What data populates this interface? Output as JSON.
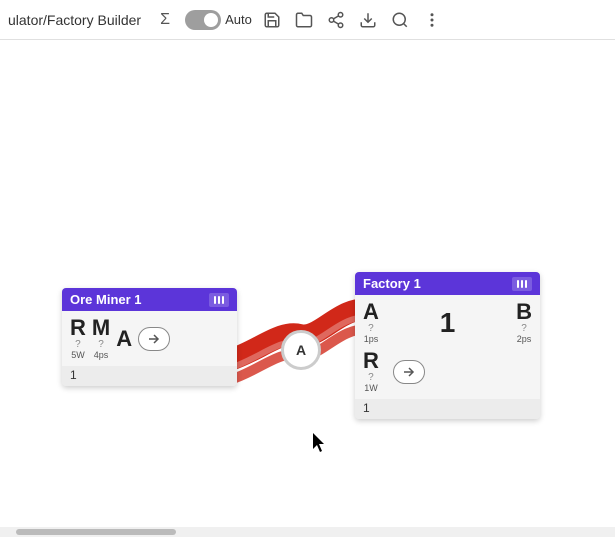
{
  "toolbar": {
    "title": "ulator/Factory Builder",
    "sigma_label": "Σ",
    "auto_label": "Auto",
    "save_label": "💾",
    "folder_label": "📁",
    "share_label": "⬡",
    "download_label": "⬇",
    "search_label": "🔍",
    "more_label": "⋮"
  },
  "ore_miner_node": {
    "title": "Ore Miner 1",
    "footer": "1",
    "port_r": {
      "letter": "R",
      "question": "?",
      "rate": "5W"
    },
    "port_m": {
      "letter": "M",
      "question": "?",
      "rate": "4ps"
    },
    "port_a": {
      "letter": "A"
    },
    "arrow_label": "→"
  },
  "factory_node": {
    "title": "Factory 1",
    "footer": "1",
    "port_a": {
      "letter": "A",
      "question": "?",
      "rate": "1ps"
    },
    "port_mid": {
      "letter": "1"
    },
    "port_b": {
      "letter": "B",
      "question": "?",
      "rate": "2ps"
    },
    "port_r": {
      "letter": "R",
      "question": "?",
      "rate": "1W"
    },
    "arrow_label": "→"
  },
  "connector": {
    "label": "A"
  }
}
